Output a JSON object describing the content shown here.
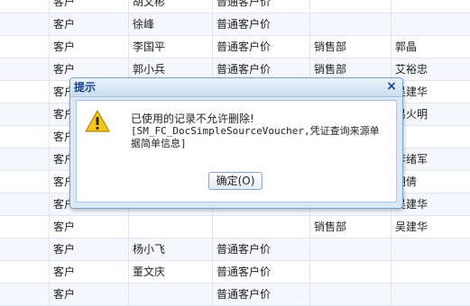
{
  "grid": {
    "rows": [
      [
        "客户",
        "胡文彬",
        "普通客户价",
        "",
        ""
      ],
      [
        "客户",
        "徐峰",
        "普通客户价",
        "",
        ""
      ],
      [
        "客户",
        "李国平",
        "普通客户价",
        "销售部",
        "郭晶"
      ],
      [
        "客户",
        "郭小兵",
        "普通客户价",
        "销售部",
        "艾裕忠"
      ],
      [
        "客户",
        "",
        "",
        "",
        "吴建华"
      ],
      [
        "客户",
        "",
        "",
        "",
        "易火明"
      ],
      [
        "客户",
        "",
        "",
        "",
        ""
      ],
      [
        "客户",
        "",
        "",
        "",
        "李绪军"
      ],
      [
        "客户",
        "",
        "",
        "",
        "胡倩"
      ],
      [
        "客户",
        "",
        "",
        "",
        "吴建华"
      ],
      [
        "客户",
        "",
        "",
        "销售部",
        "吴建华"
      ],
      [
        "客户",
        "杨小飞",
        "普通客户价",
        "",
        ""
      ],
      [
        "客户",
        "董文庆",
        "普通客户价",
        "",
        ""
      ],
      [
        "客户",
        "",
        "普通客户价",
        "",
        ""
      ]
    ]
  },
  "dialog": {
    "title": "提示",
    "close_symbol": "×",
    "message_line1": "已使用的记录不允许删除!",
    "message_line2": "[SM_FC_DocSimpleSourceVoucher,凭证查询来源单据简单信息]",
    "ok_label": "确定(O)",
    "icon": "warning-icon",
    "icon_color": "#f5c518"
  }
}
